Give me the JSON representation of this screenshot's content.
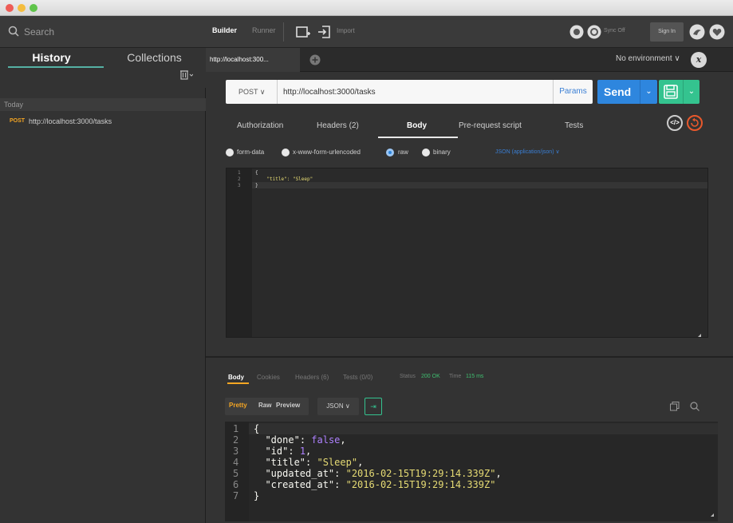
{
  "sidebar": {
    "search_placeholder": "Search",
    "tabs": [
      "History",
      "Collections"
    ],
    "section": "Today",
    "history": [
      {
        "method": "POST",
        "url": "http://localhost:3000/tasks"
      }
    ]
  },
  "toolbar": {
    "tabs": [
      "Builder",
      "Runner"
    ],
    "import_label": "Import",
    "sync_label": "Sync Off",
    "signin_label": "Sign In"
  },
  "request_tabs": {
    "active_tab": "http://localhost:300...",
    "environment": "No environment",
    "environment_caret": "∨"
  },
  "request": {
    "method": "POST",
    "method_caret": "∨",
    "url": "http://localhost:3000/tasks",
    "params_label": "Params",
    "send_label": "Send",
    "caret": "⌄",
    "tabs": [
      "Authorization",
      "Headers (2)",
      "Body",
      "Pre-request script",
      "Tests"
    ],
    "active_tab": "Body",
    "body_types": [
      "form-data",
      "x-www-form-urlencoded",
      "raw",
      "binary"
    ],
    "selected_body_type": "raw",
    "content_type": "JSON (application/json) ∨",
    "body_lines": [
      "{",
      "    \"title\": \"Sleep\"",
      "}"
    ],
    "body_line_numbers": [
      "1",
      "2",
      "3"
    ]
  },
  "response": {
    "tabs": [
      "Body",
      "Cookies",
      "Headers (6)",
      "Tests (0/0)"
    ],
    "active_tab": "Body",
    "status_label": "Status",
    "status_value": "200 OK",
    "time_label": "Time",
    "time_value": "115 ms",
    "formats": [
      "Pretty",
      "Raw",
      "Preview"
    ],
    "active_format": "Pretty",
    "language": "JSON ∨",
    "line_numbers": [
      "1",
      "2",
      "3",
      "4",
      "5",
      "6",
      "7"
    ],
    "json": {
      "open": "{",
      "done_key": "\"done\"",
      "done_val": "false",
      "id_key": "\"id\"",
      "id_val": "1",
      "title_key": "\"title\"",
      "title_val": "\"Sleep\"",
      "updated_key": "\"updated_at\"",
      "updated_val": "\"2016-02-15T19:29:14.339Z\"",
      "created_key": "\"created_at\"",
      "created_val": "\"2016-02-15T19:29:14.339Z\"",
      "close": "}"
    }
  },
  "colors": {
    "accent_teal": "#55b1a4",
    "send_blue": "#2e86de",
    "save_green": "#34c38f",
    "method_orange": "#f5a623",
    "status_green": "#3fbf70"
  },
  "icons": [
    "search-icon",
    "trash-icon",
    "new-window-icon",
    "import-icon",
    "proxy-icon",
    "sync-icon",
    "user-icon",
    "heart-icon",
    "plus-icon",
    "save-icon",
    "code-icon",
    "reset-icon",
    "copy-icon",
    "magnifier-icon"
  ]
}
